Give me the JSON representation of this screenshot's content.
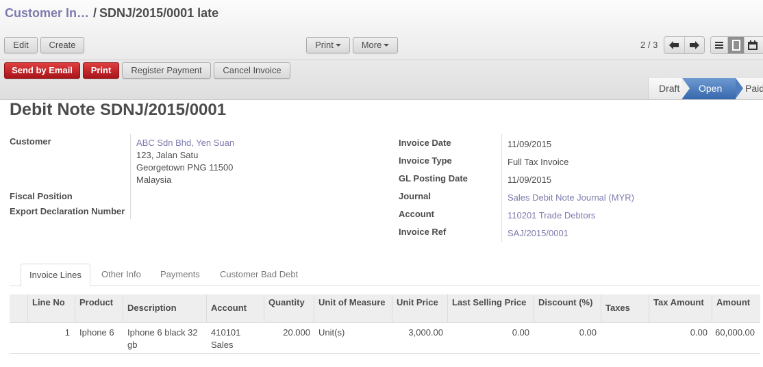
{
  "breadcrumb": {
    "parent": "Customer In…",
    "separator": "/",
    "current": "SDNJ/2015/0001 late"
  },
  "toolbar": {
    "edit_label": "Edit",
    "create_label": "Create",
    "print_label": "Print",
    "more_label": "More"
  },
  "pager": {
    "value": "2 / 3",
    "prev_icon": "arrow-left-icon",
    "next_icon": "arrow-right-icon"
  },
  "view_switcher": {
    "views": [
      {
        "name": "list",
        "icon": "list-icon",
        "active": false
      },
      {
        "name": "form",
        "icon": "form-icon",
        "active": true
      },
      {
        "name": "calendar",
        "icon": "calendar-icon",
        "active": false
      }
    ]
  },
  "header_buttons": {
    "send_email_label": "Send by Email",
    "print_label": "Print",
    "register_payment_label": "Register Payment",
    "cancel_invoice_label": "Cancel Invoice"
  },
  "statusbar": {
    "stages": [
      {
        "label": "Draft",
        "active": false
      },
      {
        "label": "Open",
        "active": true
      },
      {
        "label": "Paid",
        "active": false
      }
    ],
    "active_color": "#3d6fb4"
  },
  "document": {
    "title_prefix": "Debit Note",
    "title_number": "SDNJ/2015/0001"
  },
  "left_fields": {
    "customer_label": "Customer",
    "customer_name": "ABC Sdn Bhd, Yen Suan",
    "customer_address_1": "123, Jalan Satu",
    "customer_address_2": "Georgetown PNG 11500",
    "customer_address_3": "Malaysia",
    "fiscal_position_label": "Fiscal Position",
    "fiscal_position_value": "",
    "export_decl_label": "Export Declaration Number",
    "export_decl_value": ""
  },
  "right_fields": {
    "invoice_date_label": "Invoice Date",
    "invoice_date_value": "11/09/2015",
    "invoice_type_label": "Invoice Type",
    "invoice_type_value": "Full Tax Invoice",
    "gl_posting_date_label": "GL Posting Date",
    "gl_posting_date_value": "11/09/2015",
    "journal_label": "Journal",
    "journal_value": "Sales Debit Note Journal (MYR)",
    "account_label": "Account",
    "account_value": "110201 Trade Debtors",
    "invoice_ref_label": "Invoice Ref",
    "invoice_ref_value": "SAJ/2015/0001"
  },
  "tabs": [
    {
      "label": "Invoice Lines",
      "active": true
    },
    {
      "label": "Other Info",
      "active": false
    },
    {
      "label": "Payments",
      "active": false
    },
    {
      "label": "Customer Bad Debt",
      "active": false
    }
  ],
  "invoice_lines": {
    "columns": [
      "Line No",
      "Product",
      "Description",
      "Account",
      "Quantity",
      "Unit of Measure",
      "Unit Price",
      "Last Selling Price",
      "Discount (%)",
      "Taxes",
      "Tax Amount",
      "Amount"
    ],
    "rows": [
      {
        "line_no": "1",
        "product": "Iphone 6",
        "description_1": "Iphone 6 black 32",
        "description_2": "gb",
        "account_1": "410101",
        "account_2": "Sales",
        "quantity": "20.000",
        "uom": "Unit(s)",
        "unit_price": "3,000.00",
        "last_selling_price": "0.00",
        "discount": "0.00",
        "taxes": "",
        "tax_amount": "0.00",
        "amount": "60,000.00"
      }
    ]
  }
}
